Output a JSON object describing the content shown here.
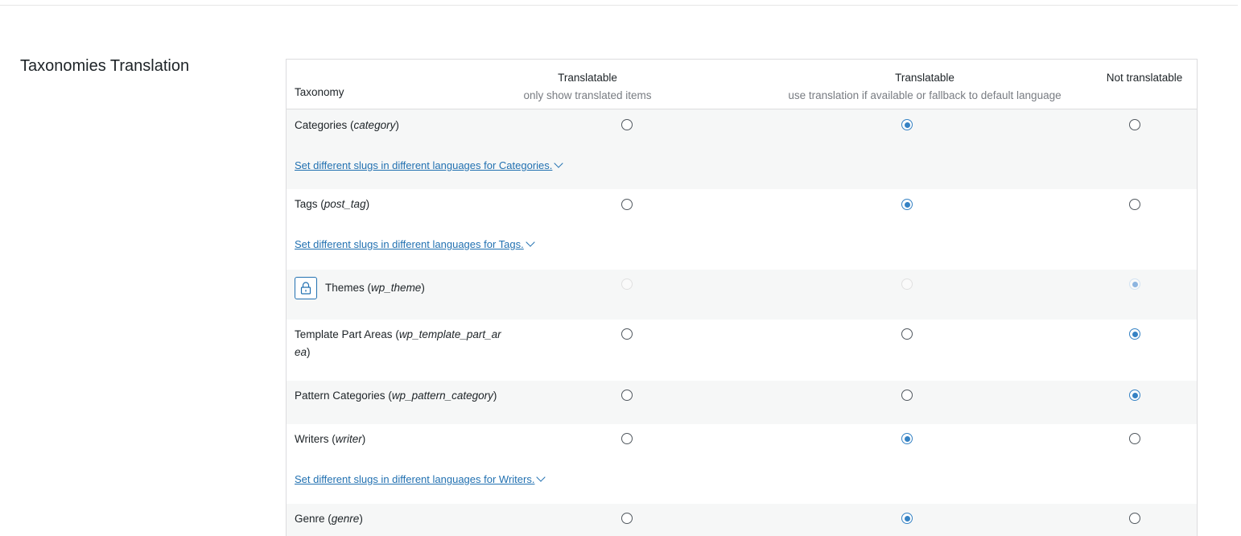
{
  "section_title": "Taxonomies Translation",
  "table": {
    "header": {
      "taxonomy": "Taxonomy",
      "col1_title": "Translatable",
      "col1_sub": "only show translated items",
      "col2_title": "Translatable",
      "col2_sub": "use translation if available or fallback to default language",
      "col3_title": "Not translatable"
    },
    "rows": [
      {
        "name": "Categories",
        "slug": "category",
        "selected": "translatable_fallback",
        "slug_link": "Set different slugs in different languages for Categories."
      },
      {
        "name": "Tags",
        "slug": "post_tag",
        "selected": "translatable_fallback",
        "slug_link": "Set different slugs in different languages for Tags."
      },
      {
        "name": "Themes",
        "slug": "wp_theme",
        "selected": "not_translatable",
        "locked": true
      },
      {
        "name": "Template Part Areas",
        "slug_part1": "wp_template_part_ar",
        "slug_part2": "ea",
        "selected": "not_translatable"
      },
      {
        "name": "Pattern Categories",
        "slug": "wp_pattern_category",
        "selected": "not_translatable"
      },
      {
        "name": "Writers",
        "slug": "writer",
        "selected": "translatable_fallback",
        "slug_link": "Set different slugs in different languages for Writers."
      },
      {
        "name": "Genre",
        "slug": "genre",
        "selected": "translatable_fallback"
      }
    ]
  },
  "colors": {
    "accent": "#3582c4",
    "link": "#2271b1",
    "alt_row": "#f6f7f7"
  },
  "icons": {
    "lock": "lock-icon",
    "chevron": "chevron-down-icon"
  }
}
